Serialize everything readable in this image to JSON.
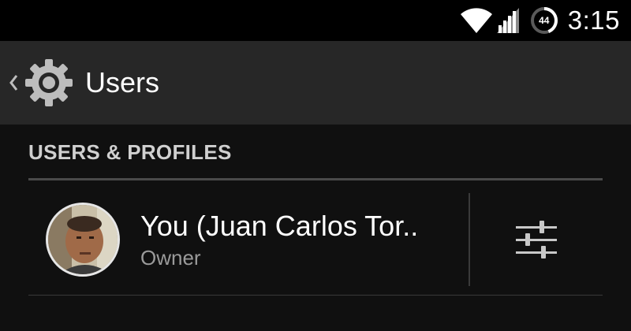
{
  "status_bar": {
    "battery_level": "44",
    "time": "3:15",
    "icons": [
      "wifi-icon",
      "signal-icon",
      "battery-icon"
    ]
  },
  "action_bar": {
    "title": "Users",
    "icons": [
      "back-chevron-icon",
      "settings-gear-icon"
    ]
  },
  "section": {
    "header": "USERS & PROFILES"
  },
  "user": {
    "name": "You (Juan Carlos Tor..",
    "role": "Owner",
    "settings_icon": "sliders-icon"
  },
  "colors": {
    "status_bar_bg": "#000000",
    "action_bar_bg": "#272727",
    "content_bg": "#101010",
    "primary_text": "#ffffff",
    "secondary_text": "#9a9a9a",
    "section_text": "#d0d0d0"
  }
}
